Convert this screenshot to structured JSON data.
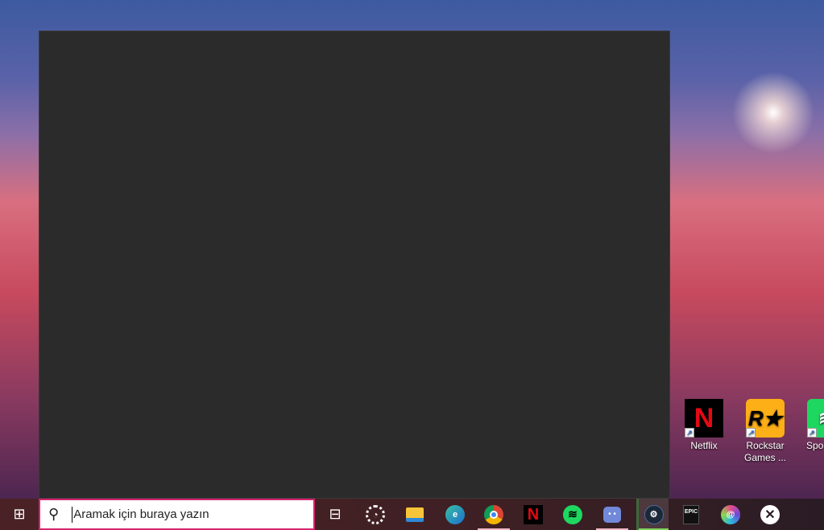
{
  "desktop": {
    "icons": [
      {
        "label": "Netflix",
        "icon": "netflix-icon"
      },
      {
        "label": "Rockstar Games ...",
        "icon": "rockstar-icon"
      },
      {
        "label": "Spo",
        "icon": "spotify-icon"
      }
    ]
  },
  "taskbar": {
    "search_placeholder": "Aramak için buraya yazın",
    "apps": [
      "task-view",
      "cortana",
      "file-explorer",
      "edge",
      "chrome",
      "netflix",
      "spotify",
      "discord",
      "steam",
      "epic-games",
      "ubisoft-connect",
      "xbox"
    ],
    "epic_label": "EPIC"
  },
  "colors": {
    "search_border": "#d6246e",
    "active_underline": "#7fd35a",
    "open_underline": "#f0b8c8"
  }
}
